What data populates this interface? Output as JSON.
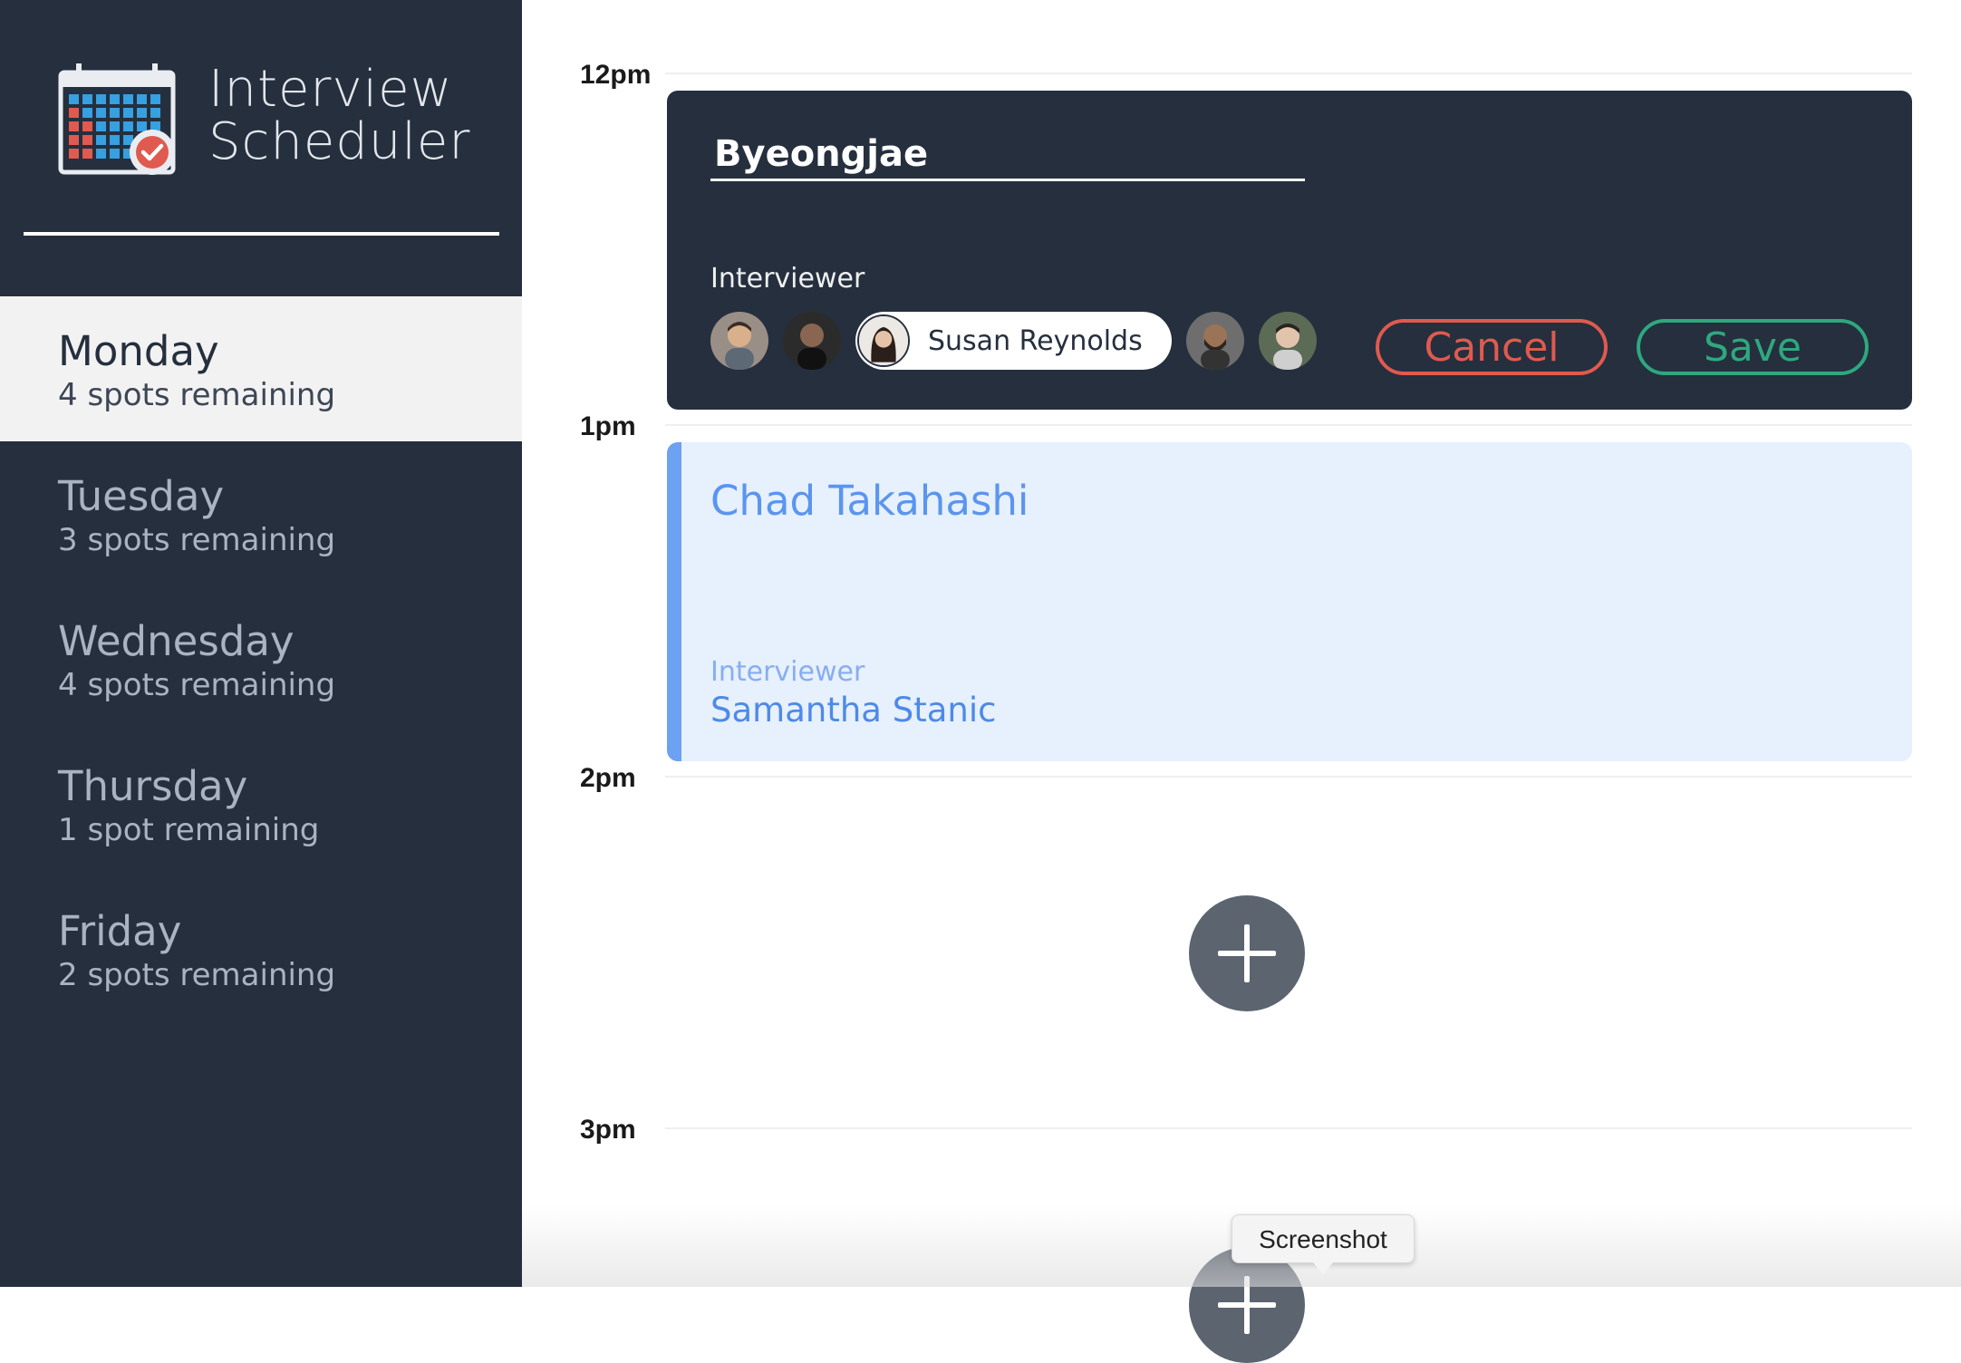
{
  "app": {
    "title_line1": "Interview",
    "title_line2": "Scheduler",
    "logo_icon": "calendar-check-icon"
  },
  "days": [
    {
      "name": "Monday",
      "spots": "4 spots remaining",
      "selected": true
    },
    {
      "name": "Tuesday",
      "spots": "3 spots remaining",
      "selected": false
    },
    {
      "name": "Wednesday",
      "spots": "4 spots remaining",
      "selected": false
    },
    {
      "name": "Thursday",
      "spots": "1 spot remaining",
      "selected": false
    },
    {
      "name": "Friday",
      "spots": "2 spots remaining",
      "selected": false
    }
  ],
  "schedule": {
    "hours": [
      "12pm",
      "1pm",
      "2pm",
      "3pm"
    ],
    "edit_form": {
      "student_name": "Byeongjae",
      "interviewer_label": "Interviewer",
      "selected_interviewer": "Susan Reynolds",
      "cancel_label": "Cancel",
      "save_label": "Save"
    },
    "appointment": {
      "student": "Chad Takahashi",
      "interviewer_label": "Interviewer",
      "interviewer": "Samantha Stanic"
    },
    "add_icon": "plus-icon"
  },
  "tooltip": {
    "text": "Screenshot"
  },
  "colors": {
    "sidebar": "#252f3e",
    "selected_day_bg": "#f2f2f2",
    "cancel": "#e05a4f",
    "save": "#2ea87e",
    "appointment_bg": "#e7f0fd",
    "appointment_accent": "#6da1f2",
    "add_button": "#5c6470"
  }
}
